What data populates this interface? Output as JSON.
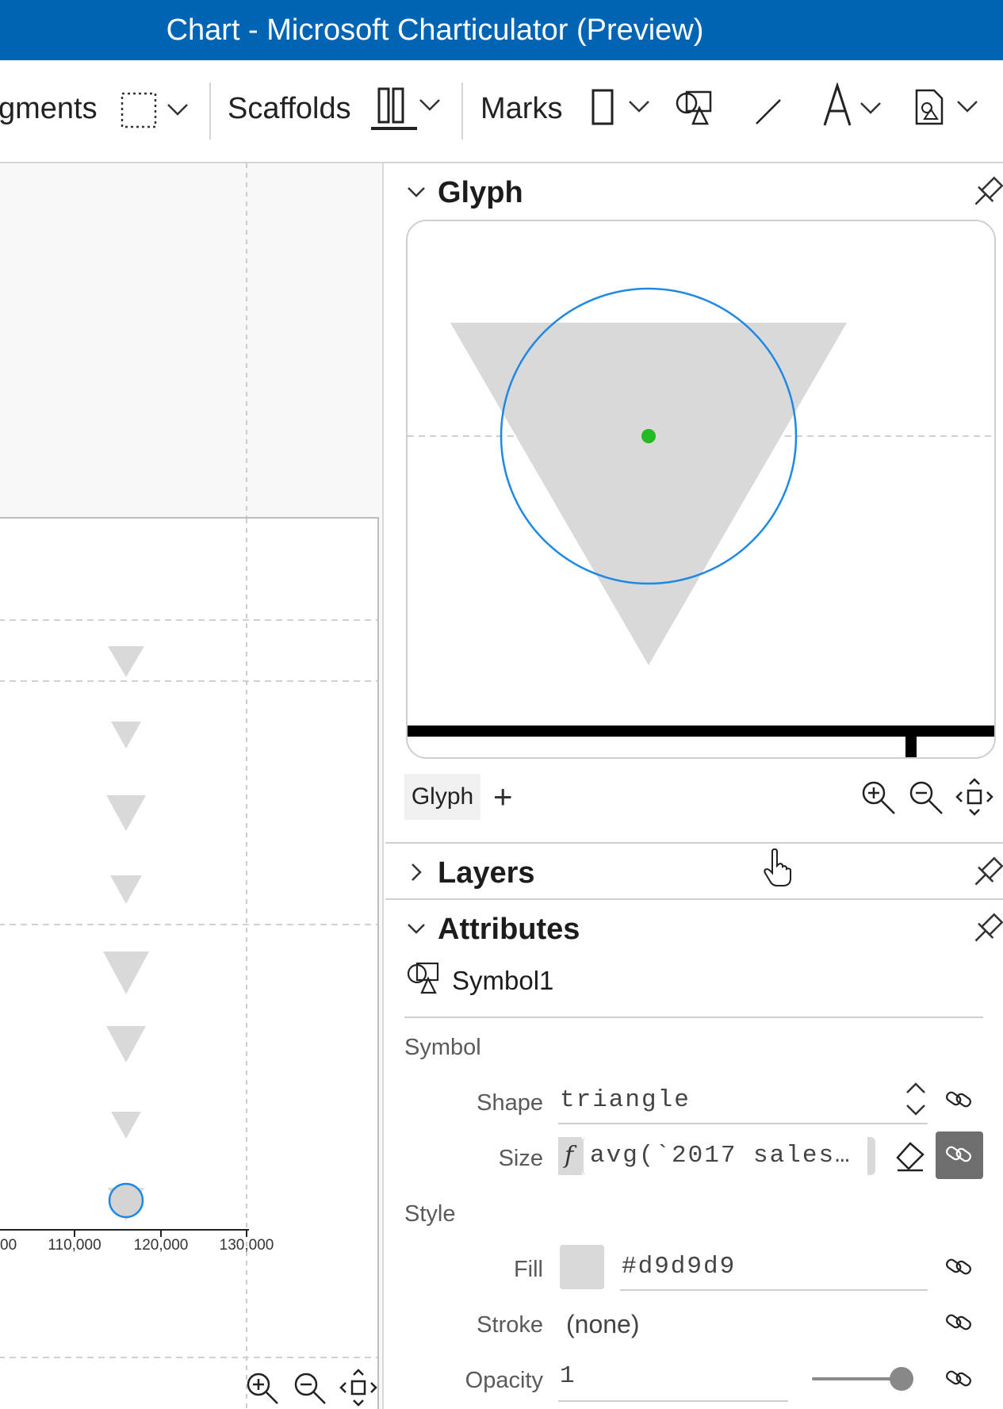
{
  "window": {
    "title": "Chart - Microsoft Charticulator (Preview)"
  },
  "toolbar": {
    "segments_label": "gments",
    "scaffolds_label": "Scaffolds",
    "marks_label": "Marks"
  },
  "canvas": {
    "x_tick_labels": [
      "00",
      "110,000",
      "120,000",
      "130,000"
    ]
  },
  "glyph_panel": {
    "title": "Glyph",
    "tab_label": "Glyph",
    "add_label": "+"
  },
  "layers_panel": {
    "title": "Layers"
  },
  "attributes_panel": {
    "title": "Attributes",
    "object_name": "Symbol1",
    "symbol_section": "Symbol",
    "shape_label": "Shape",
    "shape_value": "triangle",
    "size_label": "Size",
    "size_fx": "f",
    "size_value": "avg(`2017 sales…",
    "style_section": "Style",
    "fill_label": "Fill",
    "fill_value": "#d9d9d9",
    "stroke_label": "Stroke",
    "stroke_value": "(none)",
    "opacity_label": "Opacity",
    "opacity_value": "1"
  },
  "colors": {
    "title_bar": "#0064b4",
    "mark_fill": "#d9d9d9",
    "selection": "#1e88e5",
    "anchor": "#22bb22"
  },
  "icons": [
    "marquee-select-icon",
    "scaffold-icon",
    "rectangle-mark-icon",
    "symbol-mark-icon",
    "line-mark-icon",
    "text-mark-icon",
    "image-mark-icon",
    "pin-icon",
    "zoom-in-icon",
    "zoom-out-icon",
    "fit-view-icon",
    "link-icon",
    "eraser-icon",
    "chevron-down-icon",
    "chevron-right-icon",
    "hand-cursor-icon"
  ]
}
